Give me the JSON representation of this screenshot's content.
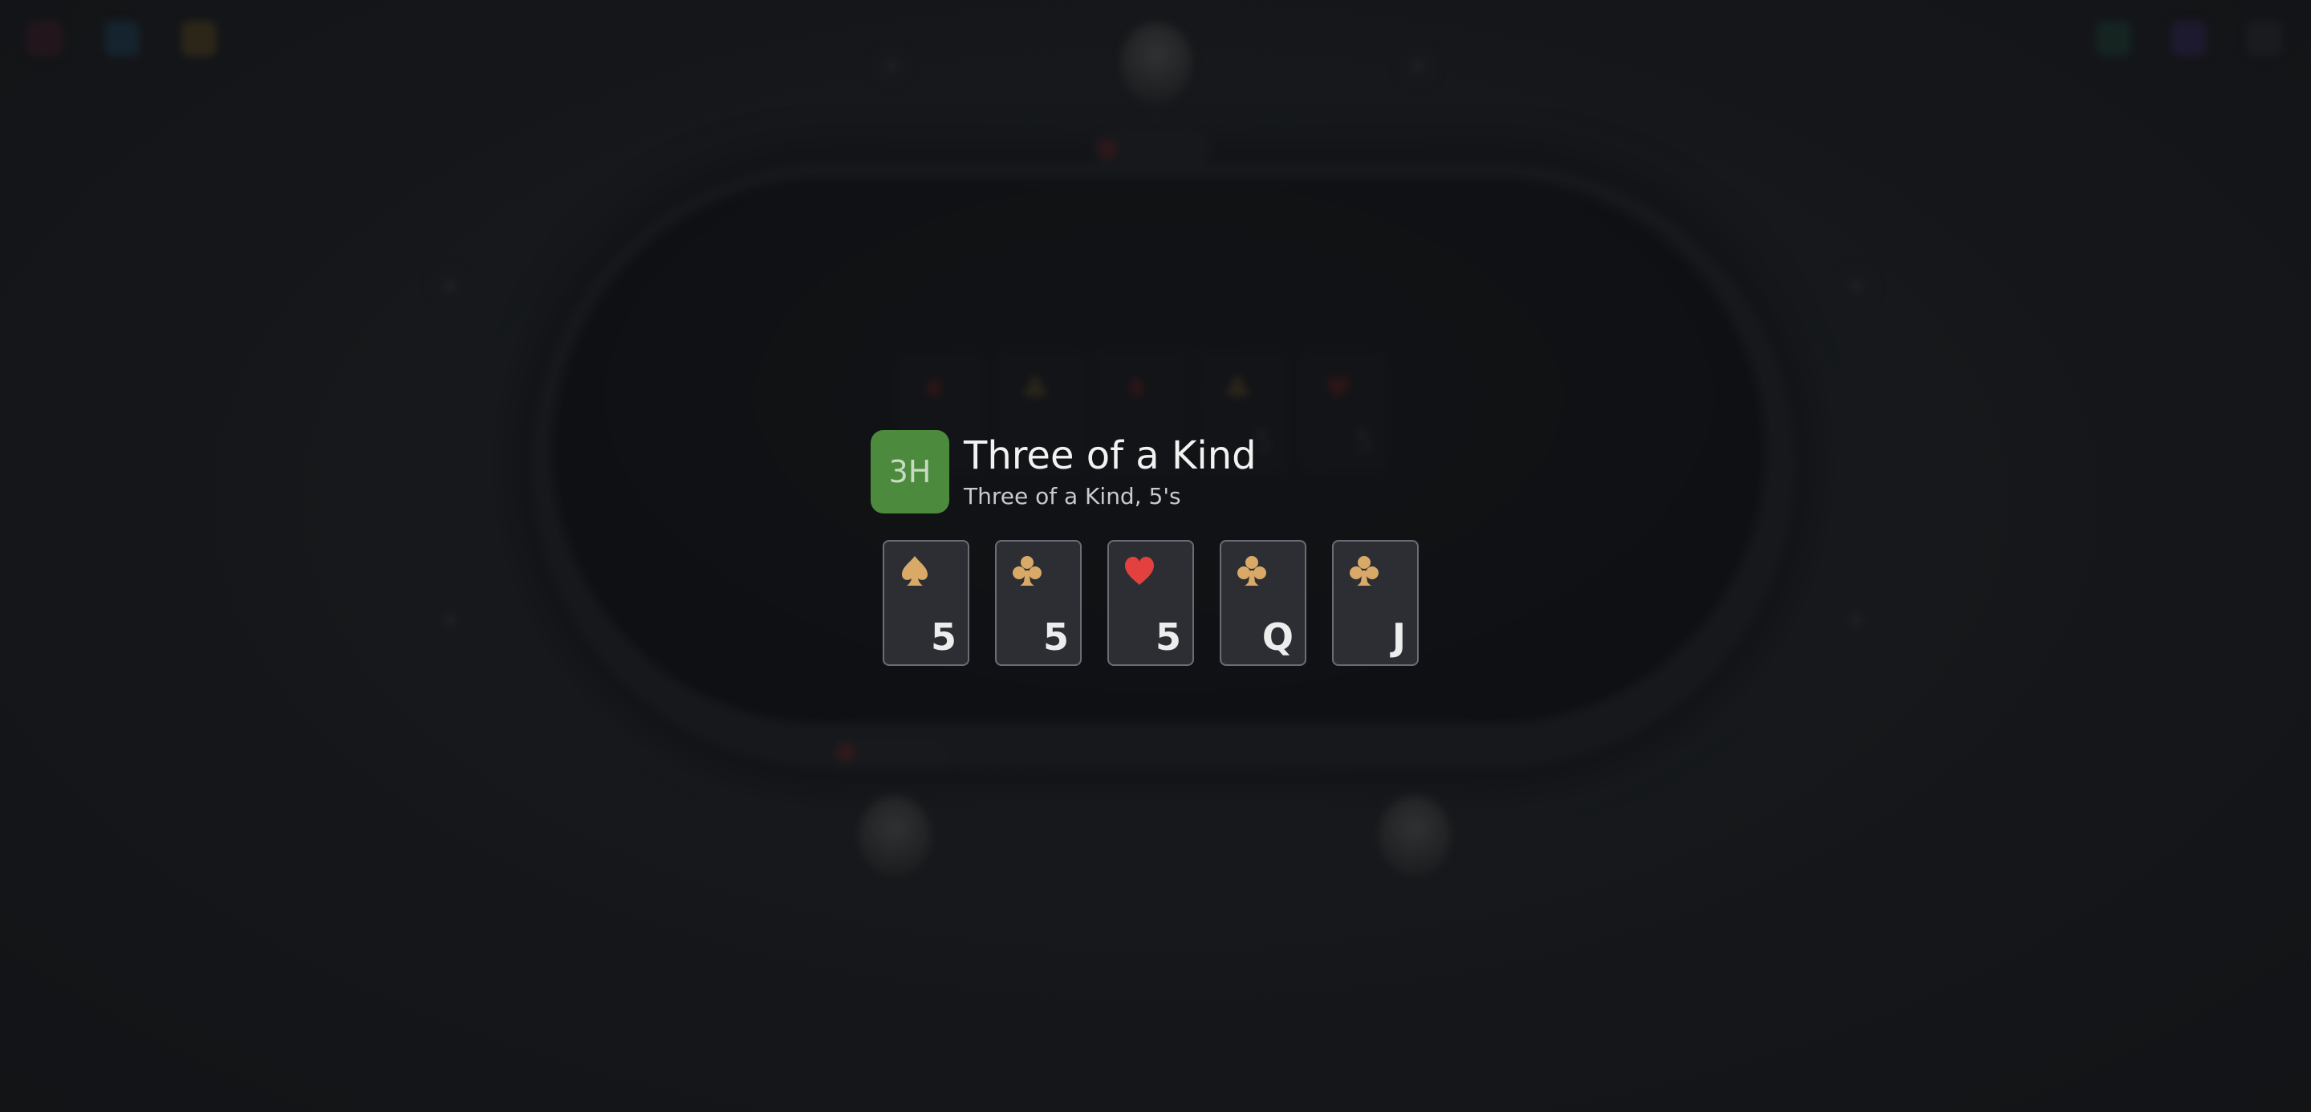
{
  "colors": {
    "badge_bg": "#4c8a3e",
    "card_bg": "#2c2e34",
    "club_spade": "#d9a968",
    "heart": "#e2413f"
  },
  "hand_result": {
    "badge": "3H",
    "title": "Three of a Kind",
    "subtitle": "Three of a Kind, 5's"
  },
  "best_hand_cards": [
    {
      "rank": "5",
      "suit": "spades",
      "icon": "spade-icon"
    },
    {
      "rank": "5",
      "suit": "clubs",
      "icon": "club-icon"
    },
    {
      "rank": "5",
      "suit": "hearts",
      "icon": "heart-icon"
    },
    {
      "rank": "Q",
      "suit": "clubs",
      "icon": "club-icon"
    },
    {
      "rank": "J",
      "suit": "clubs",
      "icon": "club-icon"
    }
  ]
}
